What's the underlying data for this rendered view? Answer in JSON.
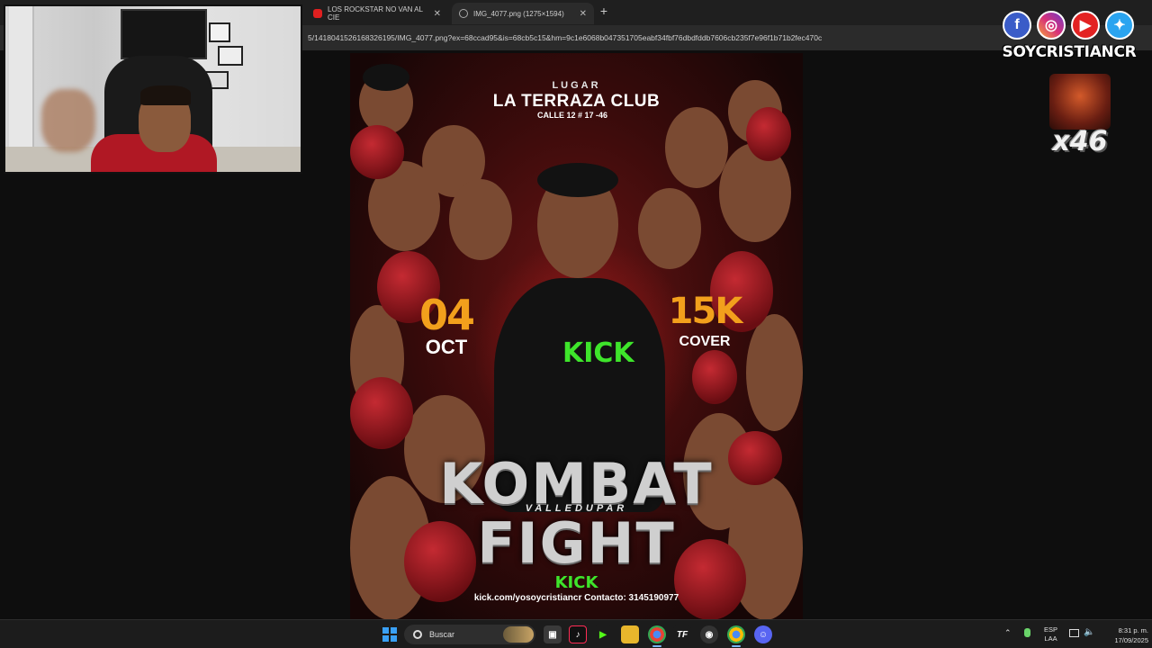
{
  "browser": {
    "tabs": [
      {
        "label": "LOS ROCKSTAR NO VAN AL CIE",
        "active": false
      },
      {
        "label": "IMG_4077.png (1275×1594)",
        "active": true
      }
    ],
    "url": "5/1418041526168326195/IMG_4077.png?ex=68ccad95&is=68cb5c15&hm=9c1e6068b047351705eabf34fbf76dbdfddb7606cb235f7e96f1b71b2fec470c"
  },
  "overlay": {
    "handle": "SOYCRISTIANCR",
    "socials": [
      "facebook-icon",
      "instagram-icon",
      "youtube-icon",
      "twitter-icon"
    ],
    "gift_count": "x46"
  },
  "poster": {
    "lugar": "LUGAR",
    "venue": "LA TERRAZA CLUB",
    "address": "CALLE 12 # 17 -46",
    "day": "04",
    "month": "OCT",
    "price": "15K",
    "price_label": "COVER",
    "shirt_text": "KICK",
    "title_line1": "KOMBAT",
    "city": "VALLEDUPAR",
    "title_line2": "FIGHT",
    "platform": "KICK",
    "contact": "kick.com/yosoycristiancr  Contacto: 3145190977"
  },
  "taskbar": {
    "search_placeholder": "Buscar",
    "lang_line1": "ESP",
    "lang_line2": "LAA",
    "time": "8:31 p. m.",
    "date": "17/09/2025"
  },
  "colors": {
    "accent_orange": "#f2a01c",
    "kick_green": "#3ee52b",
    "poster_red": "#6a1414"
  }
}
